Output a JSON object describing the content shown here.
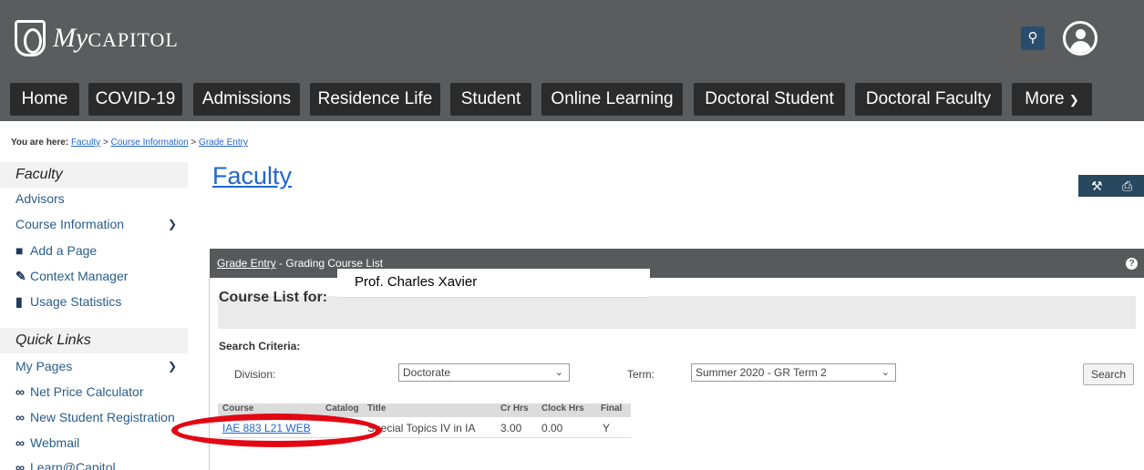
{
  "logo": {
    "my": "My",
    "capitol": "CAPITOL"
  },
  "header": {
    "search_icon": "search-icon",
    "user_icon": "user-circle-icon"
  },
  "nav": [
    "Home",
    "COVID-19",
    "Admissions",
    "Residence Life",
    "Student",
    "Online Learning",
    "Doctoral Student",
    "Doctoral Faculty",
    "More"
  ],
  "breadcrumb": {
    "prefix": "You are here:",
    "items": [
      "Faculty",
      "Course Information",
      "Grade Entry"
    ],
    "sep": " > "
  },
  "sidebar": {
    "heading": "Faculty",
    "items": [
      {
        "label": "Advisors"
      },
      {
        "label": "Course Information"
      },
      {
        "label": "Add a Page",
        "icon": "folder-plus-icon"
      },
      {
        "label": "Context Manager",
        "icon": "edit-icon"
      },
      {
        "label": "Usage Statistics",
        "icon": "bar-chart-icon"
      }
    ],
    "quick_heading": "Quick Links",
    "quick_items": [
      {
        "label": "My Pages"
      },
      {
        "label": "Net Price Calculator",
        "icon": "link-icon"
      },
      {
        "label": "New Student Registration",
        "icon": "link-icon"
      },
      {
        "label": "Webmail",
        "icon": "link-icon"
      },
      {
        "label": "Learn@Capitol",
        "icon": "link-icon"
      }
    ]
  },
  "main": {
    "title": "Faculty",
    "panel": {
      "link": "Grade Entry",
      "rest": " - Grading Course List"
    },
    "course_list_label": "Course List for:",
    "professor": "Prof. Charles Xavier",
    "search_criteria": "Search Criteria:",
    "division_label": "Division:",
    "division_value": "Doctorate",
    "term_label": "Term:",
    "term_value": "Summer 2020 - GR Term 2",
    "search_button": "Search",
    "table": {
      "headers": [
        "Course",
        "Catalog",
        "Title",
        "Cr Hrs",
        "Clock Hrs",
        "Final"
      ],
      "rows": [
        {
          "course": "IAE 883 L21 WEB",
          "title": "Special Topics IV in IA",
          "cr_hrs": "3.00",
          "clock_hrs": "0.00",
          "final": "Y"
        }
      ]
    }
  }
}
